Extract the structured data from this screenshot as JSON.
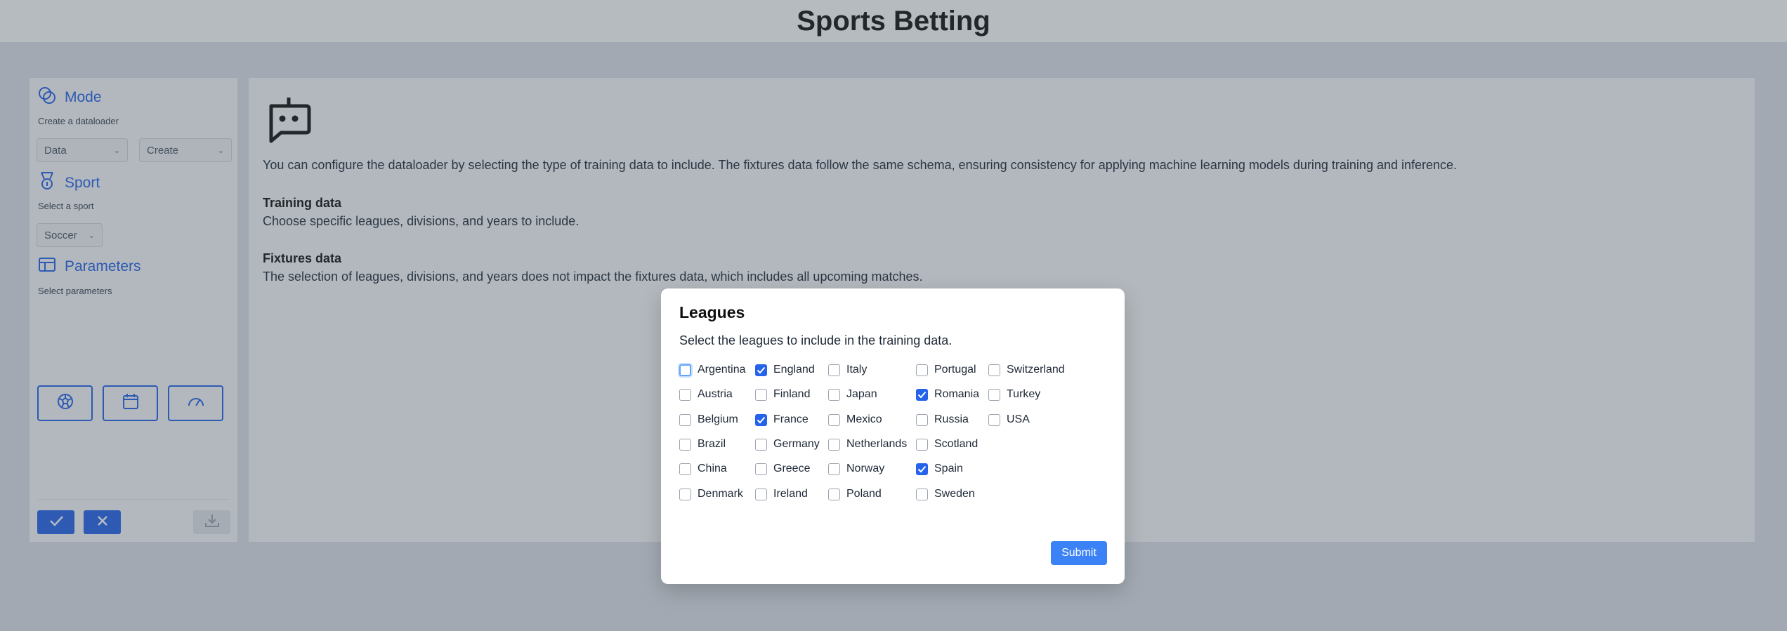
{
  "header": {
    "title": "Sports Betting"
  },
  "sidebar": {
    "mode": {
      "title": "Mode",
      "subtitle": "Create a dataloader",
      "select1": "Data",
      "select2": "Create"
    },
    "sport": {
      "title": "Sport",
      "subtitle": "Select a sport",
      "select": "Soccer"
    },
    "parameters": {
      "title": "Parameters",
      "subtitle": "Select parameters",
      "buttons": [
        "soccer-ball-icon",
        "calendar-icon",
        "gauge-icon"
      ]
    },
    "actions": {
      "confirm_icon": "check-icon",
      "cancel_icon": "close-icon",
      "download_icon": "download-icon"
    }
  },
  "main": {
    "intro": "You can configure the dataloader by selecting the type of training data to include. The fixtures data follow the same schema, ensuring consistency for applying machine learning models during training and inference.",
    "training": {
      "title": "Training data",
      "text": "Choose specific leagues, divisions, and years to include."
    },
    "fixtures": {
      "title": "Fixtures data",
      "text": "The selection of leagues, divisions, and years does not impact the fixtures data, which includes all upcoming matches."
    }
  },
  "modal": {
    "title": "Leagues",
    "description": "Select the leagues to include in the training data.",
    "columns": [
      [
        {
          "label": "Argentina",
          "checked": false
        },
        {
          "label": "Austria",
          "checked": false
        },
        {
          "label": "Belgium",
          "checked": false
        },
        {
          "label": "Brazil",
          "checked": false
        },
        {
          "label": "China",
          "checked": false
        },
        {
          "label": "Denmark",
          "checked": false
        }
      ],
      [
        {
          "label": "England",
          "checked": true
        },
        {
          "label": "Finland",
          "checked": false
        },
        {
          "label": "France",
          "checked": true
        },
        {
          "label": "Germany",
          "checked": false
        },
        {
          "label": "Greece",
          "checked": false
        },
        {
          "label": "Ireland",
          "checked": false
        }
      ],
      [
        {
          "label": "Italy",
          "checked": false
        },
        {
          "label": "Japan",
          "checked": false
        },
        {
          "label": "Mexico",
          "checked": false
        },
        {
          "label": "Netherlands",
          "checked": false
        },
        {
          "label": "Norway",
          "checked": false
        },
        {
          "label": "Poland",
          "checked": false
        }
      ],
      [
        {
          "label": "Portugal",
          "checked": false
        },
        {
          "label": "Romania",
          "checked": true
        },
        {
          "label": "Russia",
          "checked": false
        },
        {
          "label": "Scotland",
          "checked": false
        },
        {
          "label": "Spain",
          "checked": true
        },
        {
          "label": "Sweden",
          "checked": false
        }
      ],
      [
        {
          "label": "Switzerland",
          "checked": false
        },
        {
          "label": "Turkey",
          "checked": false
        },
        {
          "label": "USA",
          "checked": false
        }
      ]
    ],
    "submit_label": "Submit"
  },
  "colors": {
    "accent": "#2563eb",
    "submit": "#3b82f6"
  }
}
